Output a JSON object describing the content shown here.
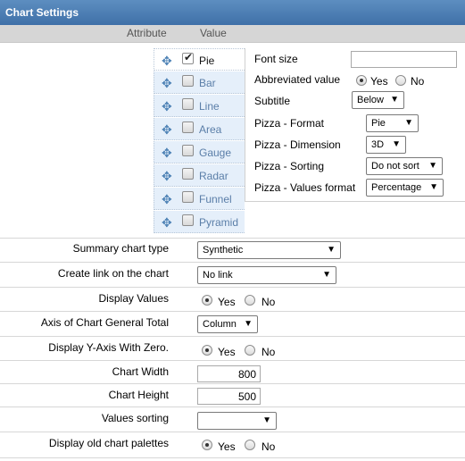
{
  "header": {
    "title": "Chart Settings"
  },
  "columns": {
    "attribute": "Attribute",
    "value": "Value"
  },
  "chart_types": [
    {
      "label": "Pie",
      "checked": true
    },
    {
      "label": "Bar",
      "checked": false
    },
    {
      "label": "Line",
      "checked": false
    },
    {
      "label": "Area",
      "checked": false
    },
    {
      "label": "Gauge",
      "checked": false
    },
    {
      "label": "Radar",
      "checked": false
    },
    {
      "label": "Funnel",
      "checked": false
    },
    {
      "label": "Pyramid",
      "checked": false
    }
  ],
  "pie_settings": {
    "font_size": {
      "label": "Font size",
      "value": ""
    },
    "abbreviated_value": {
      "label": "Abbreviated value",
      "yes": "Yes",
      "no": "No",
      "selected": "Yes"
    },
    "subtitle": {
      "label": "Subtitle",
      "value": "Below"
    },
    "pizza_format": {
      "label": "Pizza - Format",
      "value": "Pie"
    },
    "pizza_dimension": {
      "label": "Pizza - Dimension",
      "value": "3D"
    },
    "pizza_sorting": {
      "label": "Pizza - Sorting",
      "value": "Do not sort"
    },
    "pizza_values_format": {
      "label": "Pizza - Values format",
      "value": "Percentage"
    }
  },
  "settings": {
    "summary_chart_type": {
      "label": "Summary chart type",
      "value": "Synthetic"
    },
    "create_link": {
      "label": "Create link on the chart",
      "value": "No link"
    },
    "display_values": {
      "label": "Display Values",
      "yes": "Yes",
      "no": "No",
      "selected": "Yes"
    },
    "axis_general_total": {
      "label": "Axis of Chart General Total",
      "value": "Column"
    },
    "display_y_zero": {
      "label": "Display Y-Axis With Zero.",
      "yes": "Yes",
      "no": "No",
      "selected": "Yes"
    },
    "chart_width": {
      "label": "Chart Width",
      "value": "800"
    },
    "chart_height": {
      "label": "Chart Height",
      "value": "500"
    },
    "values_sorting": {
      "label": "Values sorting",
      "value": ""
    },
    "old_palettes": {
      "label": "Display old chart palettes",
      "yes": "Yes",
      "no": "No",
      "selected": "Yes"
    }
  },
  "icons": {
    "move": "move-arrows-icon",
    "check": "checkmark-icon",
    "dropdown": "caret-down-icon"
  },
  "colors": {
    "header": "#3f70a8",
    "list_bg": "#e5effa",
    "list_text": "#5a7ea8"
  }
}
